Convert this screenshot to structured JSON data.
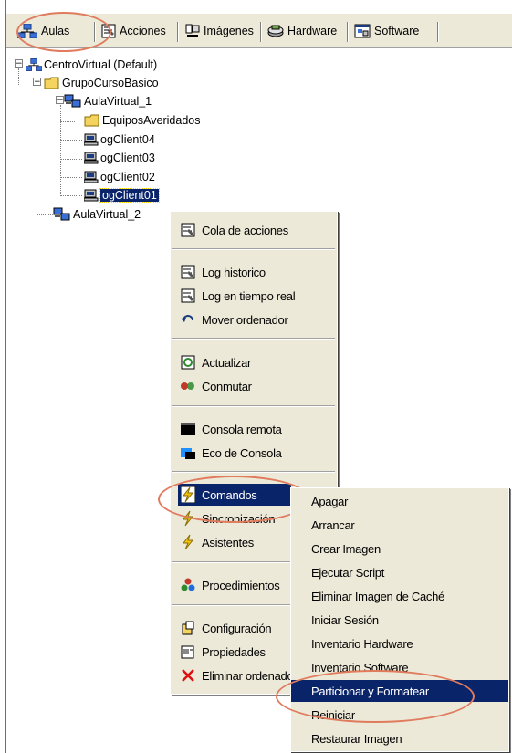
{
  "toolbar": {
    "items": [
      {
        "label": "Aulas",
        "icon": "network-icon"
      },
      {
        "label": "Acciones",
        "icon": "actions-icon"
      },
      {
        "label": "Imágenes",
        "icon": "images-icon"
      },
      {
        "label": "Hardware",
        "icon": "hardware-icon"
      },
      {
        "label": "Software",
        "icon": "software-icon"
      }
    ]
  },
  "tree": {
    "root": "CentroVirtual (Default)",
    "group": "GrupoCursoBasico",
    "room1": "AulaVirtual_1",
    "folder": "EquiposAveridados",
    "clients": [
      "ogClient04",
      "ogClient03",
      "ogClient02",
      "ogClient01"
    ],
    "room2": "AulaVirtual_2"
  },
  "context_menu": {
    "items": [
      "Cola de acciones",
      "Log historico",
      "Log en tiempo real",
      "Mover ordenador",
      "Actualizar",
      "Conmutar",
      "Consola remota",
      "Eco de Consola",
      "Comandos",
      "Sincronización",
      "Asistentes",
      "Procedimientos",
      "Configuración",
      "Propiedades",
      "Eliminar ordenador"
    ]
  },
  "submenu": {
    "items": [
      "Apagar",
      "Arrancar",
      "Crear Imagen",
      "Ejecutar Script",
      "Eliminar Imagen de Caché",
      "Iniciar Sesión",
      "Inventario Hardware",
      "Inventario Software",
      "Particionar y Formatear",
      "Reiniciar",
      "Restaurar Imagen"
    ]
  },
  "colors": {
    "selection": "#0a246a",
    "menu_bg": "#ece9d8",
    "annotation": "#e07b5d"
  }
}
